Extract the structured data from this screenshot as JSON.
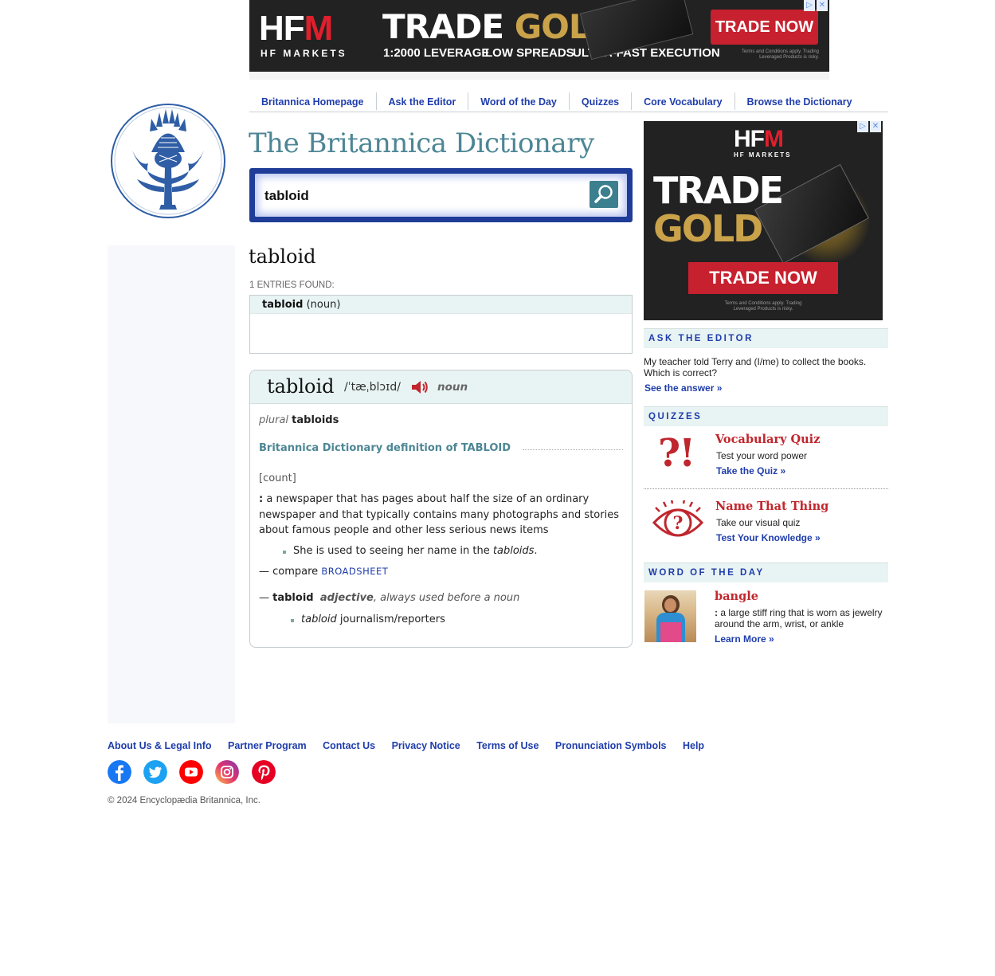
{
  "top_ad": {
    "brand": "HFM",
    "brand_sub": "HF MARKETS",
    "headline_white": "TRADE",
    "headline_gold": "GOLD",
    "features": [
      "1:2000 LEVERAGE",
      "LOW SPREADS",
      "ULTRA-FAST EXECUTION"
    ],
    "cta": "TRADE NOW",
    "fine_print": "Terms and Conditions apply. Trading Leveraged Products is risky."
  },
  "nav": {
    "items": [
      "Britannica Homepage",
      "Ask the Editor",
      "Word of the Day",
      "Quizzes",
      "Core Vocabulary",
      "Browse the Dictionary"
    ]
  },
  "site_title": "The Britannica Dictionary",
  "search": {
    "value": "tabloid"
  },
  "result": {
    "headword": "tabloid",
    "entries_label": "1 ENTRIES FOUND:",
    "entries": [
      {
        "word": "tabloid",
        "pos": "(noun)"
      }
    ]
  },
  "definition": {
    "word": "tabloid",
    "pronunciation": "/ˈtæˌblɔɪd/",
    "pos": "noun",
    "plural_label": "plural",
    "plural_form": "tabloids",
    "heading": "Britannica Dictionary definition of TABLOID",
    "usage": "[count]",
    "sense_colon": ":",
    "sense_text": "a newspaper that has pages about half the size of an ordinary newspaper and that typically contains many photographs and stories about famous people and other less serious news items",
    "example_pre": "She is used to seeing her name in the ",
    "example_italic": "tabloids",
    "example_post": ".",
    "compare_prefix": "— compare ",
    "compare_link": "BROADSHEET",
    "runon_dash": "— ",
    "runon_word": "tabloid",
    "runon_pos": "adjective",
    "runon_note": ", always used before a noun",
    "runon_example_italic": "tabloid",
    "runon_example_rest": " journalism/reporters"
  },
  "side_ad": {
    "brand": "HFM",
    "brand_sub": "HF MARKETS",
    "headline_white": "TRADE",
    "headline_gold": "GOLD",
    "cta": "TRADE NOW",
    "fine_print": "Terms and Conditions apply. Trading Leveraged Products is risky."
  },
  "ask_editor": {
    "heading": "ASK THE EDITOR",
    "question": "My teacher told Terry and (I/me) to collect the books. Which is correct?",
    "link": "See the answer »"
  },
  "quizzes": {
    "heading": "QUIZZES",
    "items": [
      {
        "title": "Vocabulary Quiz",
        "desc": "Test your word power",
        "link": "Take the Quiz »",
        "icon": "?!"
      },
      {
        "title": "Name That Thing",
        "desc": "Take our visual quiz",
        "link": "Test Your Knowledge »"
      }
    ]
  },
  "word_of_day": {
    "heading": "WORD OF THE DAY",
    "word": "bangle",
    "colon": ":",
    "definition": "a large stiff ring that is worn as jewelry around the arm, wrist, or ankle",
    "link": "Learn More »"
  },
  "footer": {
    "links": [
      "About Us & Legal Info",
      "Partner Program",
      "Contact Us",
      "Privacy Notice",
      "Terms of Use",
      "Pronunciation Symbols",
      "Help"
    ],
    "social": [
      "facebook-icon",
      "twitter-icon",
      "youtube-icon",
      "instagram-icon",
      "pinterest-icon"
    ],
    "copyright": "© 2024 Encyclopædia Britannica, Inc."
  },
  "colors": {
    "link_blue": "#1f3dab",
    "teal": "#4d8695",
    "search_frame": "#1e3c98",
    "quiz_red": "#c0262d",
    "section_bg": "#e8f3f3"
  }
}
